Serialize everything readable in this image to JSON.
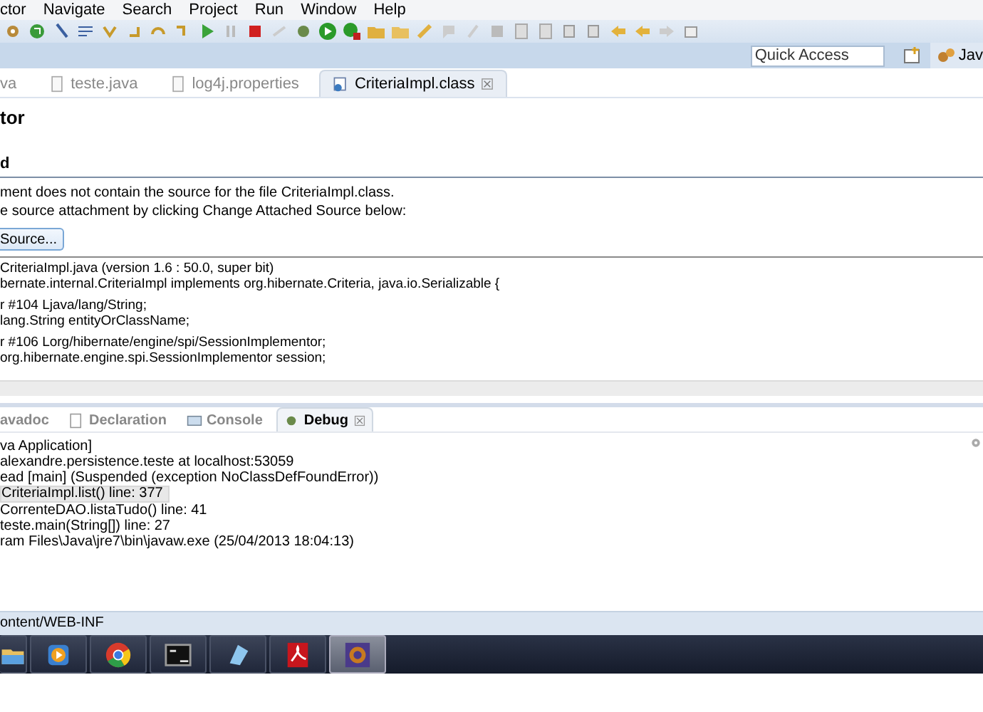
{
  "menu": [
    "ctor",
    "Navigate",
    "Search",
    "Project",
    "Run",
    "Window",
    "Help"
  ],
  "quick_access": {
    "placeholder": "Quick Access"
  },
  "perspective": {
    "label": "Jav"
  },
  "editor_tabs": [
    {
      "label": "va",
      "selected": false
    },
    {
      "label": "teste.java",
      "selected": false
    },
    {
      "label": "log4j.properties",
      "selected": false
    },
    {
      "label": "CriteriaImpl.class",
      "selected": true
    }
  ],
  "editor": {
    "title": "tor",
    "section": "d",
    "messages": [
      "ment does not contain the source for the file CriteriaImpl.class.",
      "e source attachment by clicking Change Attached Source below:"
    ],
    "button": "Source...",
    "code_blocks": [
      [
        "CriteriaImpl.java (version 1.6 : 50.0, super bit)",
        "bernate.internal.CriteriaImpl implements org.hibernate.Criteria, java.io.Serializable {"
      ],
      [
        "r #104 Ljava/lang/String;",
        "lang.String entityOrClassName;"
      ],
      [
        "r #106 Lorg/hibernate/engine/spi/SessionImplementor;",
        "org.hibernate.engine.spi.SessionImplementor session;"
      ]
    ]
  },
  "bottom_tabs": [
    {
      "label": "avadoc",
      "selected": false
    },
    {
      "label": "Declaration",
      "selected": false
    },
    {
      "label": "Console",
      "selected": false
    },
    {
      "label": "Debug",
      "selected": true
    }
  ],
  "debug_tree": [
    {
      "text": "va Application]",
      "selected": false
    },
    {
      "text": "alexandre.persistence.teste at localhost:53059",
      "selected": false
    },
    {
      "text": "ead [main] (Suspended (exception NoClassDefFoundError))",
      "selected": false
    },
    {
      "text": "CriteriaImpl.list() line: 377",
      "selected": true
    },
    {
      "text": "CorrenteDAO.listaTudo() line: 41",
      "selected": false
    },
    {
      "text": "teste.main(String[]) line: 27",
      "selected": false
    },
    {
      "text": "ram Files\\Java\\jre7\\bin\\javaw.exe (25/04/2013 18:04:13)",
      "selected": false
    }
  ],
  "status_bar": {
    "text": "ontent/WEB-INF"
  },
  "taskbar": {
    "items": [
      {
        "kind": "folder",
        "selected": false
      },
      {
        "kind": "media",
        "selected": false
      },
      {
        "kind": "browser",
        "selected": false
      },
      {
        "kind": "terminal",
        "selected": false
      },
      {
        "kind": "notepad",
        "selected": false
      },
      {
        "kind": "pdf",
        "selected": false
      },
      {
        "kind": "ide",
        "selected": true
      }
    ]
  }
}
